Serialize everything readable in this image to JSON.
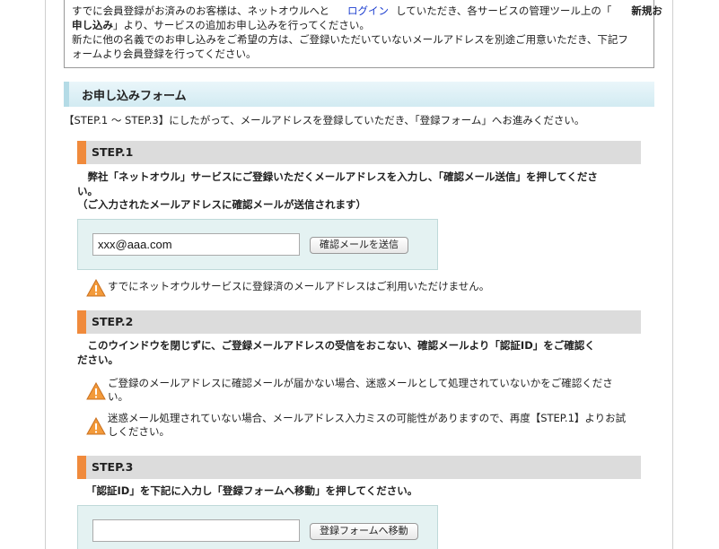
{
  "notice": {
    "line1_a": "すでに会員登録がお済みのお客様は、ネットオウルへと",
    "line1_login": "ログイン",
    "line1_b": "していただき、各サービスの管理ツール上の「",
    "line1_c": "新規お",
    "line2_a": "申し込み",
    "line2_b": "」より、サービスの追加お申し込みを行ってください。",
    "line3": "新たに他の名義でのお申し込みをご希望の方は、ご登録いただいていないメールアドレスを別途ご用意いただき、下記フ",
    "line4": "ォームより会員登録を行ってください。"
  },
  "form_heading": "お申し込みフォーム",
  "steps_intro": "【STEP.1 ～ STEP.3】にしたがって、メールアドレスを登録していただき、「登録フォーム」へお進みください。",
  "step1": {
    "title": "STEP.1",
    "desc_line1": "　弊社「ネットオウル」サービスにご登録いただくメールアドレスを入力し、「確認メール送信」を押してくださ",
    "desc_line2": "い。",
    "desc_line3": "（ご入力されたメールアドレスに確認メールが送信されます）",
    "email_value": "xxx@aaa.com",
    "button_label": "確認メールを送信",
    "warning": "すでにネットオウルサービスに登録済のメールアドレスはご利用いただけません。"
  },
  "step2": {
    "title": "STEP.2",
    "desc_line1": "　このウインドウを閉じずに、ご登録メールアドレスの受信をおこない、確認メールより「認証ID」をご確認く",
    "desc_line2": "ださい。",
    "warning1_line1": "ご登録のメールアドレスに確認メールが届かない場合、迷惑メールとして処理されていないかをご確認くださ",
    "warning1_line2": "い。",
    "warning2_line1": "迷惑メール処理されていない場合、メールアドレス入力ミスの可能性がありますので、再度【STEP.1】よりお試",
    "warning2_line2": "しください。"
  },
  "step3": {
    "title": "STEP.3",
    "desc_line1": "「認証ID」を下記に入力し「登録フォームへ移動」を押してください。",
    "auth_value": "",
    "button_label": "登録フォームへ移動"
  },
  "colors": {
    "step_accent": "#f08a3c",
    "link": "#1a3ccf",
    "heading_bg": "#d2ebf2",
    "input_box_bg": "#e4f2f2"
  },
  "icons": {
    "warning": "warning-triangle-icon"
  }
}
